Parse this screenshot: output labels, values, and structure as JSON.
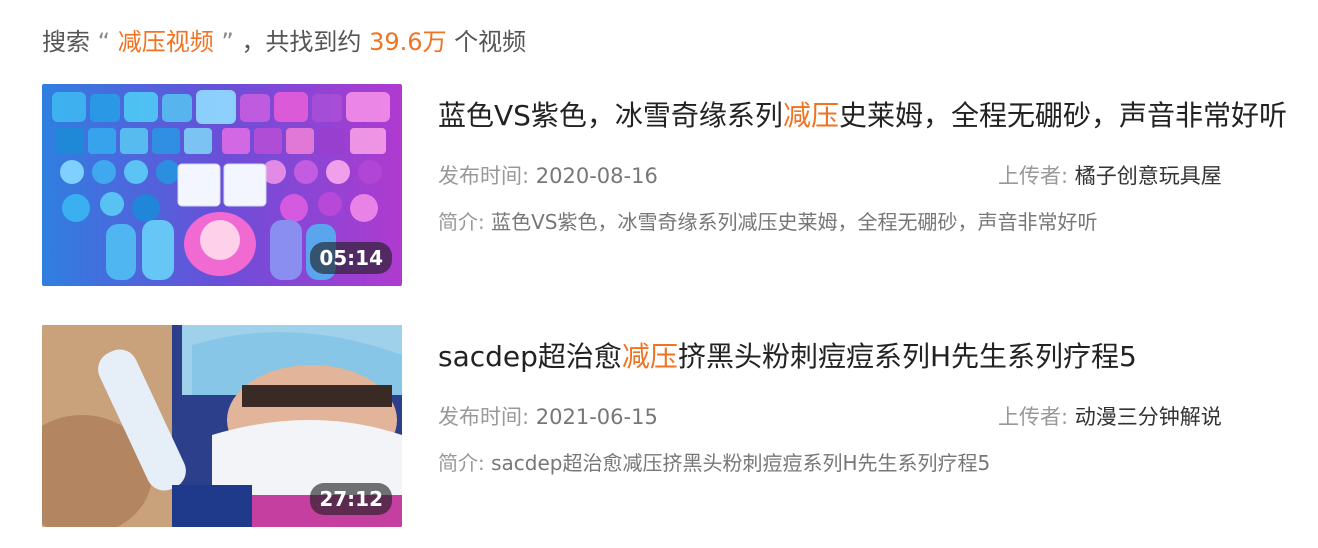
{
  "summary": {
    "prefix": "搜索",
    "open_quote": "“",
    "query": "减压视频",
    "close_quote": "”",
    "middle": "，共找到约",
    "count": "39.6万",
    "suffix": "个视频"
  },
  "results": [
    {
      "title_before": "蓝色VS紫色，冰雪奇缘系列",
      "title_highlight": "减压",
      "title_after": "史莱姆，全程无硼砂，声音非常好听",
      "date_label": "发布时间:",
      "date": "2020-08-16",
      "uploader_label": "上传者:",
      "uploader": "橘子创意玩具屋",
      "desc_label": "简介:",
      "desc": "蓝色VS紫色，冰雪奇缘系列减压史莱姆，全程无硼砂，声音非常好听",
      "duration": "05:14"
    },
    {
      "title_before": "sacdep超治愈",
      "title_highlight": "减压",
      "title_after": "挤黑头粉刺痘痘系列H先生系列疗程5",
      "date_label": "发布时间:",
      "date": "2021-06-15",
      "uploader_label": "上传者:",
      "uploader": "动漫三分钟解说",
      "desc_label": "简介:",
      "desc": "sacdep超治愈减压挤黑头粉刺痘痘系列H先生系列疗程5",
      "duration": "27:12"
    }
  ],
  "colors": {
    "highlight": "#f07321",
    "meta_label": "#999999"
  }
}
